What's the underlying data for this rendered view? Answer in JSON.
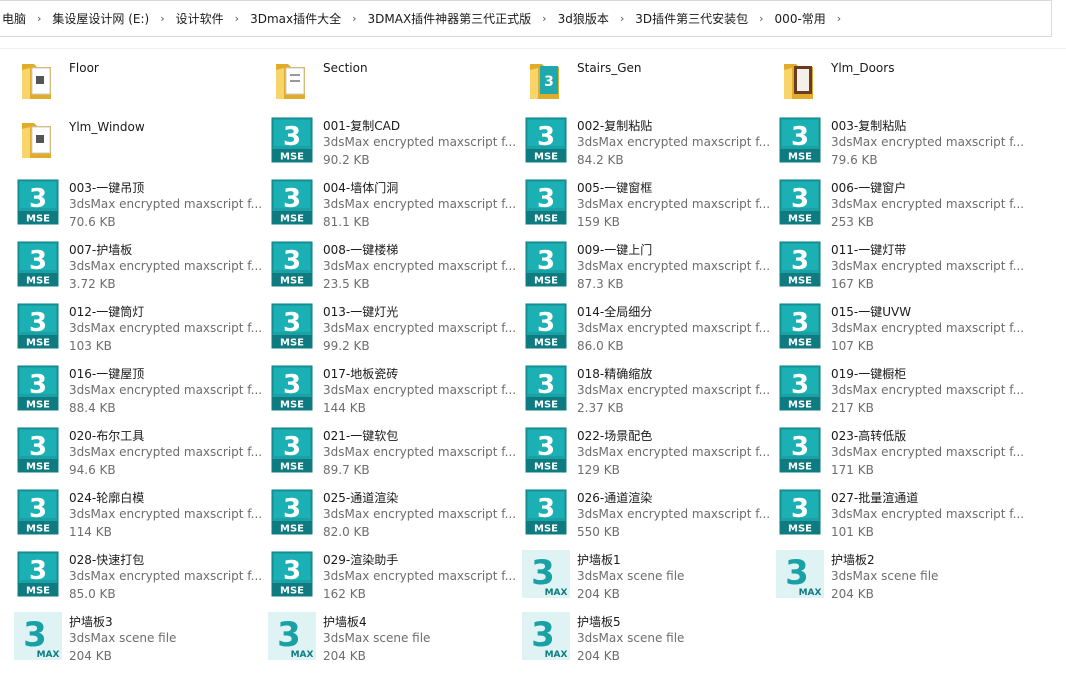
{
  "breadcrumb": [
    "电脑",
    "集设屋设计网 (E:)",
    "设计软件",
    "3Dmax插件大全",
    "3DMAX插件神器第三代正式版",
    "3d狼版本",
    "3D插件第三代安装包",
    "000-常用"
  ],
  "files": [
    {
      "kind": "folder",
      "name": "Floor",
      "type": "",
      "size": ""
    },
    {
      "kind": "folder",
      "name": "Section",
      "type": "",
      "size": ""
    },
    {
      "kind": "folder",
      "name": "Stairs_Gen",
      "type": "",
      "size": ""
    },
    {
      "kind": "folder",
      "name": "Ylm_Doors",
      "type": "",
      "size": ""
    },
    {
      "kind": "folder",
      "name": "Ylm_Window",
      "type": "",
      "size": ""
    },
    {
      "kind": "mse",
      "name": "001-复制CAD",
      "type": "3dsMax encrypted maxscript f...",
      "size": "90.2 KB"
    },
    {
      "kind": "mse",
      "name": "002-复制粘贴",
      "type": "3dsMax encrypted maxscript f...",
      "size": "84.2 KB"
    },
    {
      "kind": "mse",
      "name": "003-复制粘贴",
      "type": "3dsMax encrypted maxscript f...",
      "size": "79.6 KB"
    },
    {
      "kind": "mse",
      "name": "003-一键吊顶",
      "type": "3dsMax encrypted maxscript f...",
      "size": "70.6 KB"
    },
    {
      "kind": "mse",
      "name": "004-墙体门洞",
      "type": "3dsMax encrypted maxscript f...",
      "size": "81.1 KB"
    },
    {
      "kind": "mse",
      "name": "005-一键窗框",
      "type": "3dsMax encrypted maxscript f...",
      "size": "159 KB"
    },
    {
      "kind": "mse",
      "name": "006-一键窗户",
      "type": "3dsMax encrypted maxscript f...",
      "size": "253 KB"
    },
    {
      "kind": "mse",
      "name": "007-护墙板",
      "type": "3dsMax encrypted maxscript f...",
      "size": "3.72 KB"
    },
    {
      "kind": "mse",
      "name": "008-一键楼梯",
      "type": "3dsMax encrypted maxscript f...",
      "size": "23.5 KB"
    },
    {
      "kind": "mse",
      "name": "009-一键上门",
      "type": "3dsMax encrypted maxscript f...",
      "size": "87.3 KB"
    },
    {
      "kind": "mse",
      "name": "011-一键灯带",
      "type": "3dsMax encrypted maxscript f...",
      "size": "167 KB"
    },
    {
      "kind": "mse",
      "name": "012-一键筒灯",
      "type": "3dsMax encrypted maxscript f...",
      "size": "103 KB"
    },
    {
      "kind": "mse",
      "name": "013-一键灯光",
      "type": "3dsMax encrypted maxscript f...",
      "size": "99.2 KB"
    },
    {
      "kind": "mse",
      "name": "014-全局细分",
      "type": "3dsMax encrypted maxscript f...",
      "size": "86.0 KB"
    },
    {
      "kind": "mse",
      "name": "015-一键UVW",
      "type": "3dsMax encrypted maxscript f...",
      "size": "107 KB"
    },
    {
      "kind": "mse",
      "name": "016-一键屋顶",
      "type": "3dsMax encrypted maxscript f...",
      "size": "88.4 KB"
    },
    {
      "kind": "mse",
      "name": "017-地板瓷砖",
      "type": "3dsMax encrypted maxscript f...",
      "size": "144 KB"
    },
    {
      "kind": "mse",
      "name": "018-精确缩放",
      "type": "3dsMax encrypted maxscript f...",
      "size": "2.37 KB"
    },
    {
      "kind": "mse",
      "name": "019-一键橱柜",
      "type": "3dsMax encrypted maxscript f...",
      "size": "217 KB"
    },
    {
      "kind": "mse",
      "name": "020-布尔工具",
      "type": "3dsMax encrypted maxscript f...",
      "size": "94.6 KB"
    },
    {
      "kind": "mse",
      "name": "021-一键软包",
      "type": "3dsMax encrypted maxscript f...",
      "size": "89.7 KB"
    },
    {
      "kind": "mse",
      "name": "022-场景配色",
      "type": "3dsMax encrypted maxscript f...",
      "size": "129 KB"
    },
    {
      "kind": "mse",
      "name": "023-高转低版",
      "type": "3dsMax encrypted maxscript f...",
      "size": "171 KB"
    },
    {
      "kind": "mse",
      "name": "024-轮廓白模",
      "type": "3dsMax encrypted maxscript f...",
      "size": "114 KB"
    },
    {
      "kind": "mse",
      "name": "025-通道渲染",
      "type": "3dsMax encrypted maxscript f...",
      "size": "82.0 KB"
    },
    {
      "kind": "mse",
      "name": "026-通道渲染",
      "type": "3dsMax encrypted maxscript f...",
      "size": "550 KB"
    },
    {
      "kind": "mse",
      "name": "027-批量渲通道",
      "type": "3dsMax encrypted maxscript f...",
      "size": "101 KB"
    },
    {
      "kind": "mse",
      "name": "028-快速打包",
      "type": "3dsMax encrypted maxscript f...",
      "size": "85.0 KB"
    },
    {
      "kind": "mse",
      "name": "029-渲染助手",
      "type": "3dsMax encrypted maxscript f...",
      "size": "162 KB"
    },
    {
      "kind": "max",
      "name": "护墙板1",
      "type": "3dsMax scene file",
      "size": "204 KB"
    },
    {
      "kind": "max",
      "name": "护墙板2",
      "type": "3dsMax scene file",
      "size": "204 KB"
    },
    {
      "kind": "max",
      "name": "护墙板3",
      "type": "3dsMax scene file",
      "size": "204 KB"
    },
    {
      "kind": "max",
      "name": "护墙板4",
      "type": "3dsMax scene file",
      "size": "204 KB"
    },
    {
      "kind": "max",
      "name": "护墙板5",
      "type": "3dsMax scene file",
      "size": "204 KB"
    }
  ],
  "icon_labels": {
    "mse": "MSE",
    "max": "MAX",
    "digit": "3"
  },
  "colors": {
    "teal": "#19a1a6",
    "teal_dark": "#0d7b80",
    "folder": "#f2c94c",
    "folder_dark": "#e0ac2a"
  }
}
